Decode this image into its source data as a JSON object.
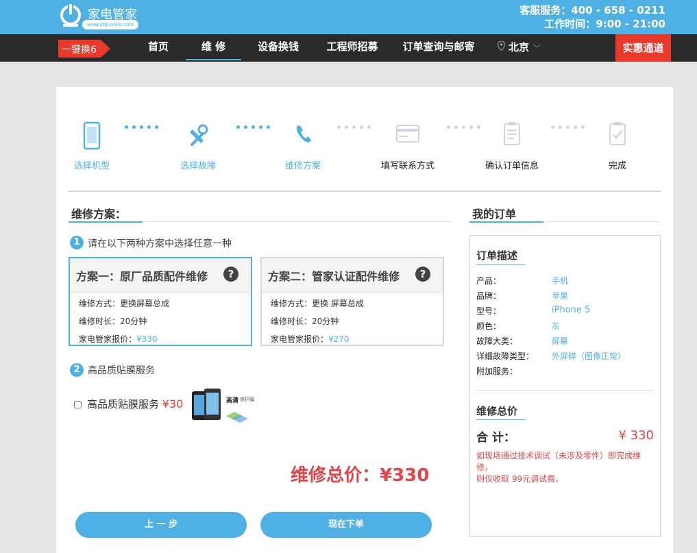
{
  "header": {
    "brand": "家电管家",
    "brand_url": "www.jdguanjia.com",
    "hotline": "客服服务：400 - 658 - 0211",
    "hours": "工作时间：9:00 - 21:00"
  },
  "nav": {
    "promo": "一键换6",
    "items": [
      {
        "label": "首页"
      },
      {
        "label": "维 修"
      },
      {
        "label": "设备换钱"
      },
      {
        "label": "工程师招募"
      },
      {
        "label": "订单查询与邮寄"
      }
    ],
    "city": "北京",
    "deal": "实惠通道"
  },
  "steps": [
    {
      "label": "选择机型",
      "icon": "phone-icon",
      "state": "done"
    },
    {
      "label": "选择故障",
      "icon": "tools-icon",
      "state": "done"
    },
    {
      "label": "维修方案",
      "icon": "call-icon",
      "state": "done"
    },
    {
      "label": "填写联系方式",
      "icon": "card-icon",
      "state": "todo"
    },
    {
      "label": "确认订单信息",
      "icon": "clipboard-icon",
      "state": "todo"
    },
    {
      "label": "完成",
      "icon": "checklist-icon",
      "state": "todo"
    }
  ],
  "repair": {
    "title": "维修方案：",
    "step1_num": "1",
    "step1_prompt": "请在以下两种方案中选择任意一种",
    "plans": [
      {
        "title": "方案一：原厂品质配件维修",
        "help": "?",
        "method": "维修方式：更换屏幕总成",
        "duration": "维修时长：20分钟",
        "price_label": "家电管家报价：",
        "price": "¥330",
        "selected": true
      },
      {
        "title": "方案二：管家认证配件维修",
        "help": "?",
        "method": "维修方式：更换 屏幕总成",
        "duration": "维修时长：20分钟",
        "price_label": "家电管家报价：",
        "price": "¥270",
        "selected": false
      }
    ],
    "step2_num": "2",
    "step2_title": "高品质贴膜服务",
    "film_label": "高品质贴膜服务",
    "film_price": "¥30",
    "film_checked": false,
    "film_image_text": "高清",
    "film_image_subtext": "保护膜",
    "total": "维修总价：¥330",
    "prev_button": "上 一 步",
    "submit_button": "现在下单"
  },
  "order": {
    "title": "我的订单",
    "desc_title": "订单描述",
    "rows": [
      {
        "k": "产品：",
        "v": "手机"
      },
      {
        "k": "品牌：",
        "v": "苹果"
      },
      {
        "k": "型号：",
        "v": "iPhone 5"
      },
      {
        "k": "颜色：",
        "v": "灰"
      },
      {
        "k": "故障大类：",
        "v": "屏幕"
      },
      {
        "k": "详细故障类型：",
        "v": "外屏碎（图像正常）"
      },
      {
        "k": "附加服务：",
        "v": ""
      }
    ],
    "total_title": "维修总价",
    "sum_label": "合 计：",
    "sum_value": "¥ 330",
    "note_line1": "如现场通过技术调试（未涉及零件）即完成维修，",
    "note_line2": "则仅收取 99元调试费。"
  },
  "colors": {
    "header": "#4fb0e4",
    "nav": "#2a2a2a",
    "accent": "#4fb0e4",
    "deal": "#e8392b",
    "price_red": "#e0454a"
  }
}
